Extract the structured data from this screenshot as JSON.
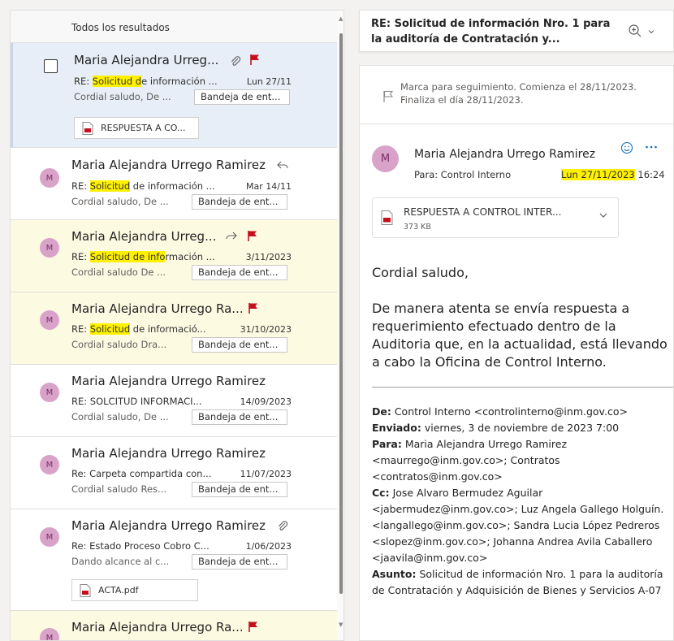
{
  "list": {
    "header": "Todos los resultados",
    "items": [
      {
        "sender": "Maria Alejandra Urreg...",
        "subject_hl": "Solicitud d",
        "subject_pre": "RE: ",
        "subject_rest": "e información ...",
        "date": "Lun 27/11",
        "preview": "Cordial saludo, De ...",
        "folder": "Bandeja de ent...",
        "attachment": "RESPUESTA A CO..."
      },
      {
        "avatar": "M",
        "sender": "Maria Alejandra Urrego Ramirez",
        "subject_pre": "RE: ",
        "subject_hl": "Solicitud",
        "subject_rest": " de información ...",
        "date": "Mar 14/11",
        "preview": "Cordial saludo, De ...",
        "folder": "Bandeja de ent..."
      },
      {
        "avatar": "M",
        "sender": "Maria Alejandra Urreg...",
        "subject_pre": "RE: ",
        "subject_hl": "Solicitud de info",
        "subject_rest": "rmación ...",
        "date": "3/11/2023",
        "preview": "Cordial saludo De ...",
        "folder": "Bandeja de ent..."
      },
      {
        "avatar": "M",
        "sender": "Maria Alejandra Urrego Ra...",
        "subject_pre": "RE: ",
        "subject_hl": "Solicitud",
        "subject_rest": " de informació...",
        "date": "31/10/2023",
        "preview": "Cordial saludo Dra...",
        "folder": "Bandeja de ent..."
      },
      {
        "avatar": "M",
        "sender": "Maria Alejandra Urrego Ramirez",
        "subject": "RE: SOLCITUD INFORMACI...",
        "date": "14/09/2023",
        "preview": "Cordial saludo, De ...",
        "folder": "Bandeja de ent..."
      },
      {
        "avatar": "M",
        "sender": "Maria Alejandra Urrego Ramirez",
        "subject": "Re: Carpeta compartida con...",
        "date": "11/07/2023",
        "preview": "Cordial saludo Res...",
        "folder": "Bandeja de ent..."
      },
      {
        "avatar": "M",
        "sender": "Maria Alejandra Urrego Ramirez",
        "subject": "Re: Estado Proceso Cobro C...",
        "date": "1/06/2023",
        "preview": "Dando alcance al c...",
        "folder": "Bandeja de ent...",
        "attachment": "ACTA.pdf"
      },
      {
        "avatar": "M",
        "sender": "Maria Alejandra Urrego Ra..."
      }
    ]
  },
  "reading": {
    "title": "RE: Solicitud de información Nro. 1 para la auditoría de Contratación y...",
    "flag_info": "Marca para seguimiento. Comienza el 28/11/2023. Finaliza el día 28/11/2023.",
    "avatar": "M",
    "sender": "Maria Alejandra Urrego Ramirez",
    "to": "Para:  Control Interno",
    "date_hl": "Lun 27/11/2023",
    "time": " 16:24",
    "attachment_name": "RESPUESTA A CONTROL INTER...",
    "attachment_size": "373 KB",
    "greeting": "Cordial saludo,",
    "body": "De manera atenta se envía respuesta a requerimiento efectuado dentro de la Auditoria que, en la actualidad, está llevando a cabo la Oficina de Control Interno.",
    "fwd": {
      "de_label": "De:",
      "de": " Control Interno <controlinterno@inm.gov.co>",
      "enviado_label": "Enviado:",
      "enviado": " viernes, 3 de noviembre de 2023 7:00",
      "para_label": "Para:",
      "para": " Maria Alejandra Urrego Ramirez <maurrego@inm.gov.co>; Contratos <contratos@inm.gov.co>",
      "cc_label": "Cc:",
      "cc": " Jose Alvaro Bermudez Aguilar <jabermudez@inm.gov.co>; Luz Angela Gallego Holguín. <langallego@inm.gov.co>; Sandra Lucia López Pedreros <slopez@inm.gov.co>; Johanna Andrea Avila Caballero <jaavila@inm.gov.co>",
      "asunto_label": "Asunto:",
      "asunto": " Solicitud de información Nro. 1 para la auditoría de Contratación y Adquisición de Bienes y Servicios A-07"
    }
  },
  "colors": {
    "flag": "#c50f1f",
    "highlight": "#fff100",
    "avatar_bg": "#d9a2c8",
    "accent": "#0f6cbd"
  }
}
